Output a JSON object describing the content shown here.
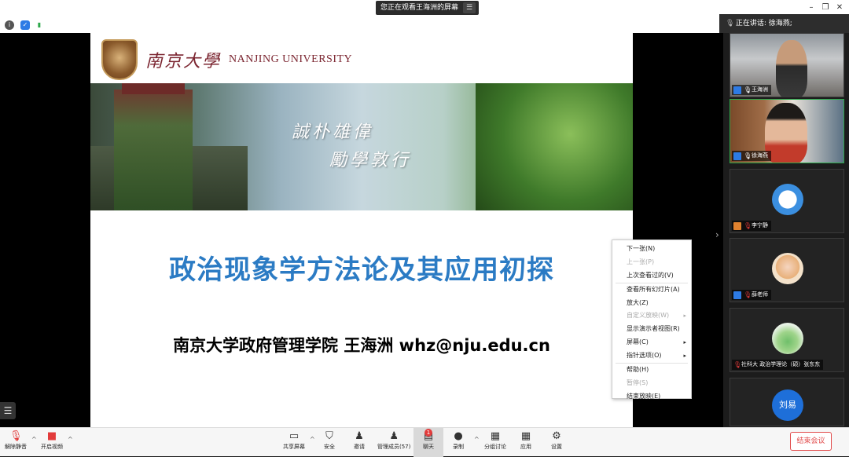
{
  "titlebar": {
    "viewing_banner": "您正在观看王海洲的屏幕",
    "menu_icon": "menu-icon"
  },
  "slide": {
    "logo_cn": "南京大學",
    "logo_en": "NANJING UNIVERSITY",
    "motto_1": "誠朴雄偉",
    "motto_2": "勵學敦行",
    "title": "政治现象学方法论及其应用初探",
    "subtitle": "南京大学政府管理学院 王海洲   whz@nju.edu.cn"
  },
  "context_menu": {
    "items": [
      {
        "label": "下一张(N)",
        "disabled": false
      },
      {
        "label": "上一张(P)",
        "disabled": true
      },
      {
        "label": "上次查看过的(V)",
        "disabled": false
      },
      {
        "label": "查看所有幻灯片(A)",
        "disabled": false
      },
      {
        "label": "放大(Z)",
        "disabled": false
      },
      {
        "label": "自定义放映(W)",
        "disabled": true,
        "submenu": true
      },
      {
        "label": "显示演示者视图(R)",
        "disabled": false
      },
      {
        "label": "屏幕(C)",
        "disabled": false,
        "submenu": true
      },
      {
        "label": "指针选项(O)",
        "disabled": false,
        "submenu": true
      },
      {
        "label": "帮助(H)",
        "disabled": false
      },
      {
        "label": "暂停(S)",
        "disabled": true
      },
      {
        "label": "结束放映(E)",
        "disabled": false
      }
    ]
  },
  "speaker_bar": {
    "label": "正在讲话: 徐海燕;"
  },
  "participants": [
    {
      "name": "王海洲"
    },
    {
      "name": "徐海燕"
    },
    {
      "name": "李宁静"
    },
    {
      "name": "薛老师"
    },
    {
      "name": "社科大 政治学理论（硕）张东东"
    },
    {
      "name": "刘易",
      "avatar_text": "刘易"
    }
  ],
  "toolbar": {
    "unmute": "解除静音",
    "start_video": "开启视频",
    "share_screen": "共享屏幕",
    "security": "安全",
    "invite": "邀请",
    "manage_participants": "管理成员(57)",
    "chat": "聊天",
    "chat_badge": "1",
    "record": "录制",
    "breakout": "分组讨论",
    "apps": "应用",
    "settings": "设置",
    "end_meeting": "结束会议"
  },
  "colors": {
    "accent_blue": "#2b7bc4",
    "end_red": "#e14a4a",
    "university_red": "#7b2530"
  }
}
